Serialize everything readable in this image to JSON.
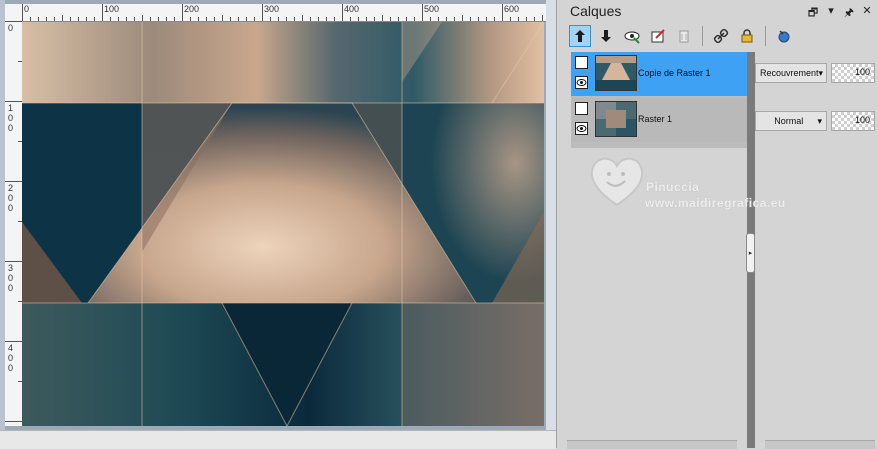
{
  "panel": {
    "title": "Calques",
    "titlebar_icons": [
      "restore-icon",
      "dropdown-arrow-icon",
      "pin-icon",
      "close-icon"
    ]
  },
  "toolbar": {
    "tools": [
      {
        "name": "move-layer-up-icon",
        "selected": true
      },
      {
        "name": "move-layer-down-icon",
        "selected": false
      },
      {
        "name": "visibility-toggle-icon",
        "selected": false
      },
      {
        "name": "edit-properties-icon",
        "selected": false
      },
      {
        "name": "delete-layer-icon",
        "selected": false
      },
      {
        "name": "link-icon",
        "selected": false
      },
      {
        "name": "lock-icon",
        "selected": false
      },
      {
        "name": "layer-style-icon",
        "selected": false
      }
    ]
  },
  "layers": [
    {
      "name": "Copie de Raster 1",
      "blend_mode": "Recouvrement",
      "opacity": "100",
      "selected": true
    },
    {
      "name": "Raster 1",
      "blend_mode": "Normal",
      "opacity": "100",
      "selected": false
    }
  ],
  "ruler": {
    "top_labels": [
      "0",
      "100",
      "200",
      "300",
      "400",
      "500",
      "600"
    ],
    "left_labels": [
      [
        "0"
      ],
      [
        "1",
        "0",
        "0"
      ],
      [
        "2",
        "0",
        "0"
      ],
      [
        "3",
        "0",
        "0"
      ],
      [
        "4",
        "0",
        "0"
      ]
    ]
  },
  "watermark": {
    "name": "Pinuccia",
    "url": "www.maidiregrafica.eu"
  },
  "colors": {
    "selected_layer": "#3fa1f3",
    "dark_teal": "#0b3344",
    "beige": "#e6c6a8"
  }
}
